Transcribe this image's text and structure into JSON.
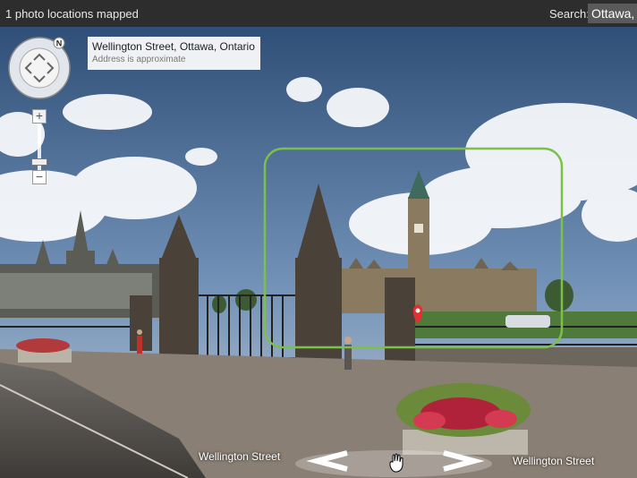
{
  "topbar": {
    "status": "1 photo locations mapped",
    "search_label": "Search:",
    "search_value": "Ottawa, C"
  },
  "address": {
    "line": "Wellington Street, Ottawa, Ontario",
    "note": "Address is approximate"
  },
  "compass": {
    "north_label": "N"
  },
  "zoom": {
    "plus": "+",
    "minus": "−"
  },
  "streets": {
    "left": "Wellington Street",
    "right": "Wellington Street"
  },
  "colors": {
    "frame": "#7cc04a",
    "marker": "#e03030"
  }
}
